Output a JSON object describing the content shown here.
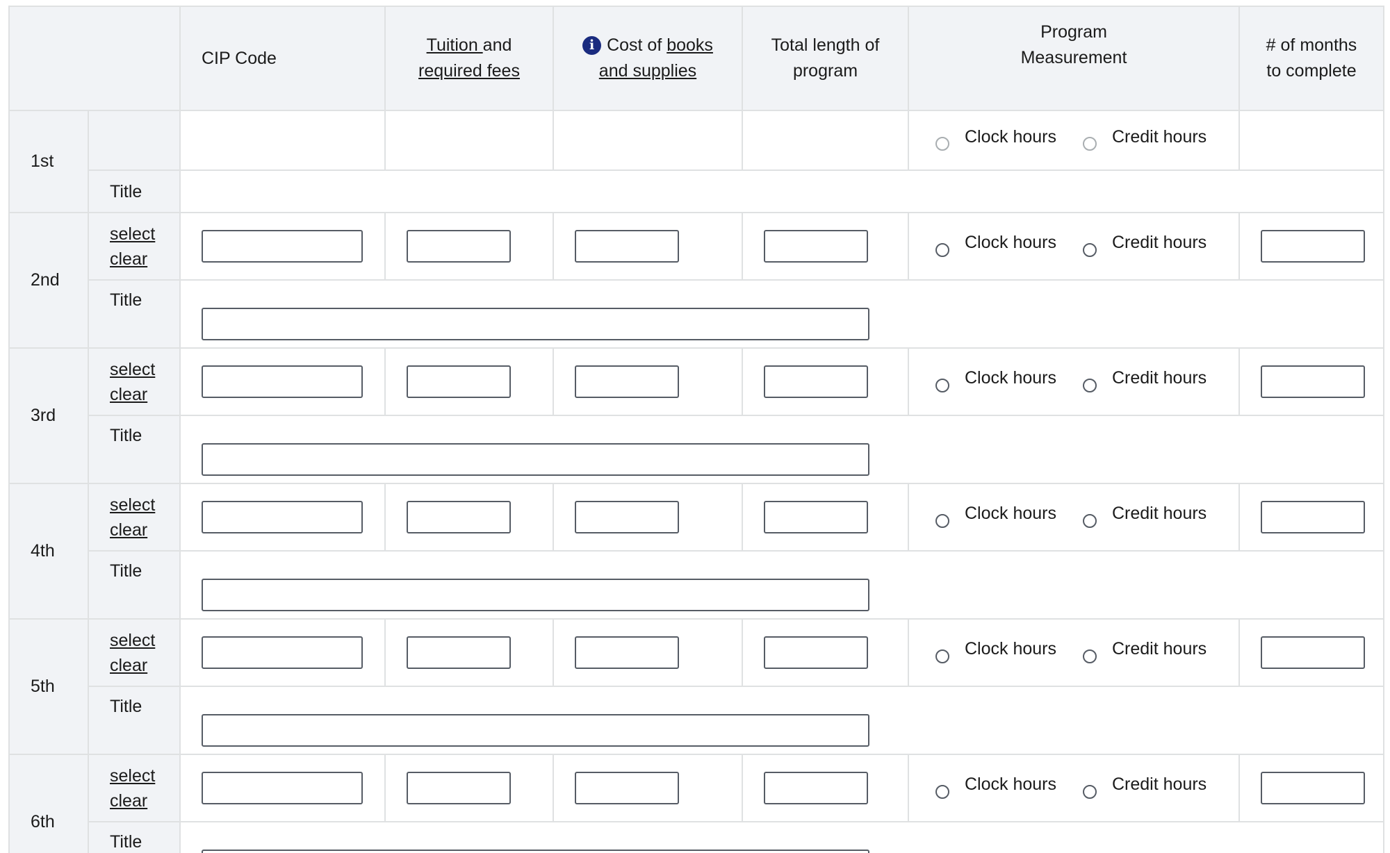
{
  "headers": {
    "cip_code": "CIP Code",
    "tuition_link": "Tuition ",
    "tuition_and": "and",
    "tuition_link2": "required fees",
    "books_pre": "Cost of ",
    "books_link": "books",
    "books_link2": "and supplies",
    "length_line1": "Total length of",
    "length_line2": "program",
    "measure_line1": "Program",
    "measure_line2": "Measurement",
    "months_line1": "# of months",
    "months_line2": "to complete"
  },
  "icons": {
    "info": "info-icon"
  },
  "labels": {
    "title": "Title",
    "select": "select",
    "clear": "clear",
    "clock": "Clock hours",
    "credit": "Credit hours"
  },
  "rows": [
    {
      "ordinal": "1st"
    },
    {
      "ordinal": "2nd"
    },
    {
      "ordinal": "3rd"
    },
    {
      "ordinal": "4th"
    },
    {
      "ordinal": "5th"
    },
    {
      "ordinal": "6th"
    }
  ]
}
